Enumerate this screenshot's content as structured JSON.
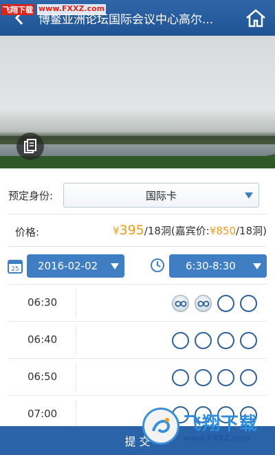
{
  "header": {
    "title": "博鳌亚洲论坛国际会议中心高尔...",
    "back_icon": "back-arrow-icon",
    "home_icon": "home-icon"
  },
  "watermark": {
    "site": "飞翔下载",
    "url": "www.FXXZ.com"
  },
  "identity": {
    "label": "预定身份:",
    "value": "国际卡"
  },
  "price": {
    "label": "价格:",
    "currency": "¥",
    "amount": "395",
    "unit": "/18洞(嘉宾价:",
    "guest_currency": "¥",
    "guest_amount": "850",
    "guest_unit": "/18洞)"
  },
  "date_picker": {
    "value": "2016-02-02",
    "icon_day": "25"
  },
  "time_picker": {
    "value": "6:30-8:30"
  },
  "slots": [
    {
      "time": "06:30",
      "status": [
        "booked",
        "booked",
        "open",
        "open"
      ]
    },
    {
      "time": "06:40",
      "status": [
        "open",
        "open",
        "open",
        "open"
      ]
    },
    {
      "time": "06:50",
      "status": [
        "open",
        "open",
        "open",
        "open"
      ]
    },
    {
      "time": "07:00",
      "status": [
        "open",
        "open",
        "open",
        "open"
      ]
    }
  ],
  "submit": {
    "label": "提 交"
  },
  "overlay_logo": {
    "cn": "飞翔下载",
    "url": "www.FXXZ.com"
  },
  "colors": {
    "primary": "#2a63a8",
    "accent": "#f29a13",
    "circle": "#2d5f98"
  }
}
